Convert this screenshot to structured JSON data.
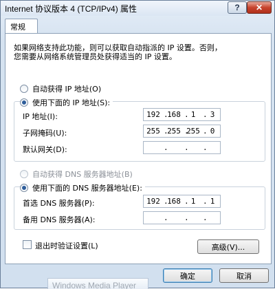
{
  "window": {
    "title": "Internet 协议版本 4 (TCP/IPv4) 属性",
    "help_label": "?",
    "close_label": "✕"
  },
  "tab": {
    "label": "常规"
  },
  "intro": {
    "line1": "如果网络支持此功能，则可以获取自动指派的 IP 设置。否则，",
    "line2": "您需要从网络系统管理员处获得适当的 IP 设置。"
  },
  "ip_mode": {
    "auto_label": "自动获得 IP 地址(O)",
    "manual_label": "使用下面的 IP 地址(S):",
    "selected": "manual"
  },
  "ip_fields": {
    "ip_label": "IP 地址(I):",
    "ip_value": [
      "192",
      "168",
      "1",
      "3"
    ],
    "mask_label": "子网掩码(U):",
    "mask_value": [
      "255",
      "255",
      "255",
      "0"
    ],
    "gateway_label": "默认网关(D):",
    "gateway_value": [
      "",
      "",
      "",
      ""
    ]
  },
  "dns_mode": {
    "auto_label": "自动获得 DNS 服务器地址(B)",
    "manual_label": "使用下面的 DNS 服务器地址(E):",
    "selected": "manual"
  },
  "dns_fields": {
    "preferred_label": "首选 DNS 服务器(P):",
    "preferred_value": [
      "192",
      "168",
      "1",
      "1"
    ],
    "alternate_label": "备用 DNS 服务器(A):",
    "alternate_value": [
      "",
      "",
      "",
      ""
    ]
  },
  "validate": {
    "label": "退出时验证设置(L)",
    "checked": false
  },
  "buttons": {
    "advanced": "高级(V)...",
    "ok": "确定",
    "cancel": "取消"
  },
  "background_window": {
    "label": "Windows Media Player"
  }
}
